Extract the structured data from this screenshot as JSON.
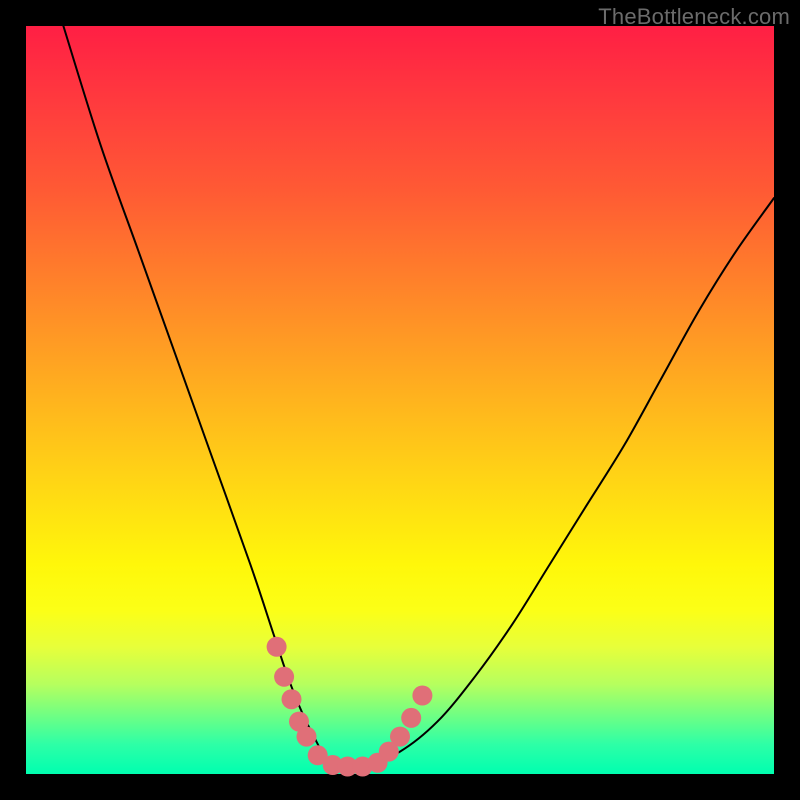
{
  "watermark": "TheBottleneck.com",
  "chart_data": {
    "type": "line",
    "title": "",
    "xlabel": "",
    "ylabel": "",
    "xlim": [
      0,
      100
    ],
    "ylim": [
      0,
      100
    ],
    "grid": false,
    "series": [
      {
        "name": "bottleneck-curve",
        "x": [
          5,
          10,
          15,
          20,
          25,
          30,
          33,
          35,
          37,
          39,
          40,
          42,
          45,
          50,
          55,
          60,
          65,
          70,
          75,
          80,
          85,
          90,
          95,
          100
        ],
        "y": [
          100,
          84,
          70,
          56,
          42,
          28,
          19,
          13,
          8,
          4,
          2,
          1,
          1,
          3,
          7,
          13,
          20,
          28,
          36,
          44,
          53,
          62,
          70,
          77
        ]
      }
    ],
    "markers": {
      "name": "highlight-dots",
      "points": [
        {
          "x": 33.5,
          "y": 17
        },
        {
          "x": 34.5,
          "y": 13
        },
        {
          "x": 35.5,
          "y": 10
        },
        {
          "x": 36.5,
          "y": 7
        },
        {
          "x": 37.5,
          "y": 5
        },
        {
          "x": 39.0,
          "y": 2.5
        },
        {
          "x": 41.0,
          "y": 1.2
        },
        {
          "x": 43.0,
          "y": 1.0
        },
        {
          "x": 45.0,
          "y": 1.0
        },
        {
          "x": 47.0,
          "y": 1.5
        },
        {
          "x": 48.5,
          "y": 3.0
        },
        {
          "x": 50.0,
          "y": 5.0
        },
        {
          "x": 51.5,
          "y": 7.5
        },
        {
          "x": 53.0,
          "y": 10.5
        }
      ]
    },
    "background_gradient": {
      "top": "#ff1f44",
      "mid": "#fff70a",
      "bottom": "#00ffb0"
    }
  }
}
